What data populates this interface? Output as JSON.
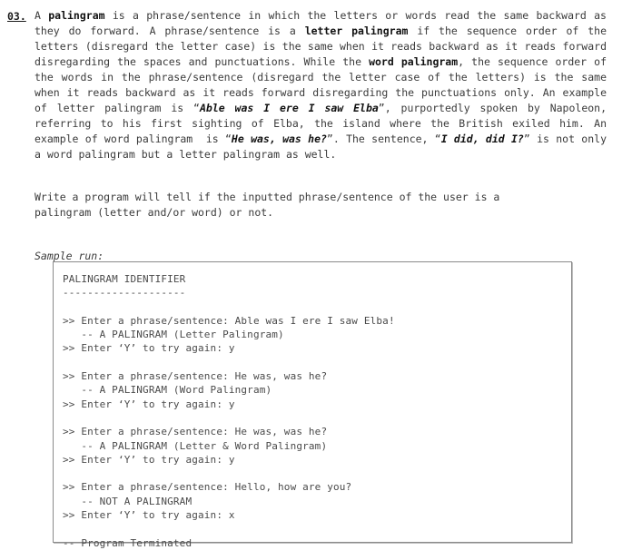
{
  "problem": {
    "number": "03.",
    "paragraph1_html": "A <b>palingram</b> is a phrase/sentence in which the letters or words read the same backward as they do forward. A phrase/sentence is a <b>letter palingram</b> if the sequence order of the letters (disregard the letter case) is the same when it reads backward as it reads forward disregarding the spaces and punctuations. While the <b>word palingram</b>, the sequence order of the words in the phrase/sentence (disregard the letter case of the letters) is the same when it reads backward as it reads forward disregarding the punctuations only. An example of letter palingram is &ldquo;<span class=\"bi\">Able was I ere I saw Elba</span>&rdquo;, purportedly spoken by Napoleon, referring to his first sighting of Elba, the island where the British exiled him. An example of word palingram &nbsp;is &ldquo;<span class=\"bi\">He was, was he?</span>&rdquo;. The sentence, &ldquo;<span class=\"bi\">I did, did I?</span>&rdquo; is not only a word palingram but a letter palingram as well.",
    "paragraph1_text": "A palingram is a phrase/sentence in which the letters or words read the same backward as they do forward. A phrase/sentence is a letter palingram if the sequence order of the letters (disregard the letter case) is the same when it reads backward as it reads forward disregarding the spaces and punctuations. While the word palingram, the sequence order of the words in the phrase/sentence (disregard the letter case of the letters) is the same when it reads backward as it reads forward disregarding the punctuations only. An example of letter palingram is \"Able was I ere I saw Elba\", purportedly spoken by Napoleon, referring to his first sighting of Elba, the island where the British exiled him. An example of word palingram is \"He was, was he?\". The sentence, \"I did, did I?\" is not only a word palingram but a letter palingram as well.",
    "paragraph2_html": "Write a program will tell if the inputted phrase/sentence of the user is a<br><span class=\"lastline\">palingram (letter and/or word) or not.</span>",
    "paragraph2_text": "Write a program will tell if the inputted phrase/sentence of the user is a palingram (letter and/or word) or not.",
    "sample_run_label": "Sample run:",
    "emphasized_terms": [
      "palingram",
      "letter palingram",
      "word palingram",
      "Able was I ere I saw Elba",
      "He was, was he?",
      "I did, did I?"
    ]
  },
  "console": {
    "title": "PALINGRAM IDENTIFIER",
    "underline": "--------------------",
    "transcript": "PALINGRAM IDENTIFIER\n--------------------\n\n>> Enter a phrase/sentence: Able was I ere I saw Elba!\n   -- A PALINGRAM (Letter Palingram)\n>> Enter ‘Y’ to try again: y\n\n>> Enter a phrase/sentence: He was, was he?\n   -- A PALINGRAM (Word Palingram)\n>> Enter ‘Y’ to try again: y\n\n>> Enter a phrase/sentence: He was, was he?\n   -- A PALINGRAM (Letter & Word Palingram)\n>> Enter ‘Y’ to try again: y\n\n>> Enter a phrase/sentence: Hello, how are you?\n   -- NOT A PALINGRAM\n>> Enter ‘Y’ to try again: x\n\n-- Program Terminated",
    "sessions": [
      {
        "prompt": ">> Enter a phrase/sentence:",
        "input": "Able was I ere I saw Elba!",
        "result": "   -- A PALINGRAM (Letter Palingram)",
        "retry_prompt": ">> Enter ‘Y’ to try again:",
        "retry_input": "y"
      },
      {
        "prompt": ">> Enter a phrase/sentence:",
        "input": "He was, was he?",
        "result": "   -- A PALINGRAM (Word Palingram)",
        "retry_prompt": ">> Enter ‘Y’ to try again:",
        "retry_input": "y"
      },
      {
        "prompt": ">> Enter a phrase/sentence:",
        "input": "He was, was he?",
        "result": "   -- A PALINGRAM (Letter & Word Palingram)",
        "retry_prompt": ">> Enter ‘Y’ to try again:",
        "retry_input": "y"
      },
      {
        "prompt": ">> Enter a phrase/sentence:",
        "input": "Hello, how are you?",
        "result": "   -- NOT A PALINGRAM",
        "retry_prompt": ">> Enter ‘Y’ to try again:",
        "retry_input": "x"
      }
    ],
    "terminated": "-- Program Terminated"
  },
  "colors": {
    "page_background": "#ffffff",
    "body_text": "#3a3a3a",
    "emphasis_text": "#111111",
    "console_text": "#4a4a4a",
    "console_border": "#8a8a8a",
    "console_shadow": "#bdbdbd"
  }
}
